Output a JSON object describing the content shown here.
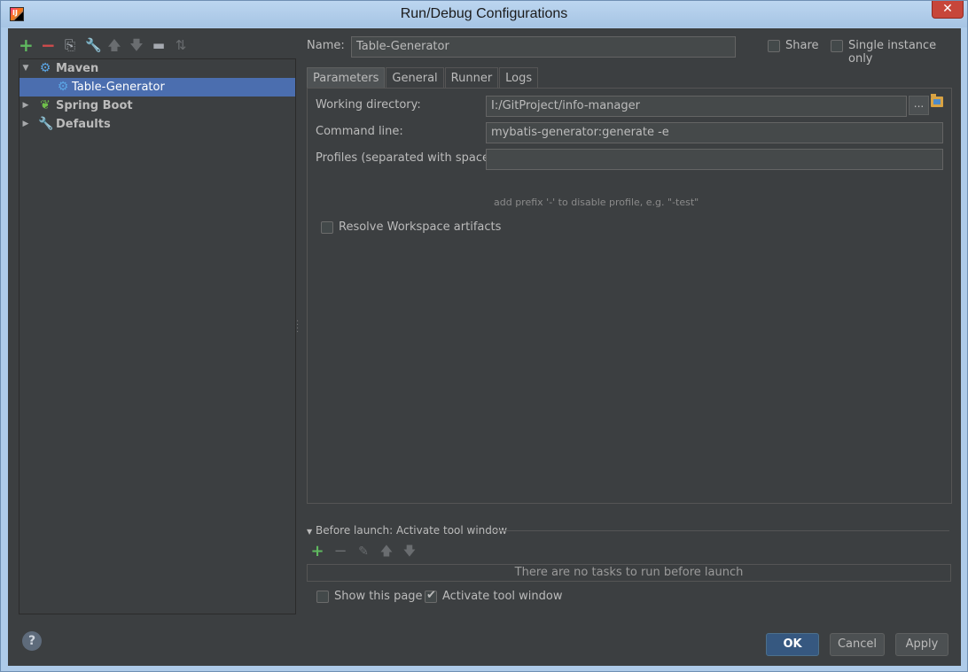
{
  "window": {
    "title": "Run/Debug Configurations"
  },
  "toolbar": {
    "icons": [
      "add-icon",
      "remove-icon",
      "copy-icon",
      "edit-defaults-icon",
      "move-up-icon",
      "move-down-icon",
      "folder-icon",
      "sort-icon"
    ],
    "add_glyph": "+",
    "remove_glyph": "−"
  },
  "tree": {
    "items": [
      {
        "label": "Maven",
        "expanded": true,
        "icon": "gear-icon"
      },
      {
        "label": "Table-Generator",
        "selected": true,
        "icon": "gear-icon"
      },
      {
        "label": "Spring Boot",
        "expanded": false,
        "icon": "spring-leaf-icon"
      },
      {
        "label": "Defaults",
        "expanded": false,
        "icon": "wrench-icon"
      }
    ]
  },
  "name": {
    "label": "Name:",
    "value": "Table-Generator"
  },
  "share": {
    "label": "Share",
    "checked": false
  },
  "single_instance": {
    "label": "Single instance only",
    "checked": false
  },
  "tabs": [
    {
      "label": "Parameters",
      "active": true
    },
    {
      "label": "General"
    },
    {
      "label": "Runner"
    },
    {
      "label": "Logs"
    }
  ],
  "parameters": {
    "working_directory": {
      "label": "Working directory:",
      "value": "I:/GitProject/info-manager",
      "browse": "..."
    },
    "command_line": {
      "label": "Command line:",
      "value": "mybatis-generator:generate -e"
    },
    "profiles": {
      "label": "Profiles (separated with space):",
      "value": "",
      "hint": "add prefix '-' to disable profile, e.g. \"-test\""
    },
    "resolve_workspace": {
      "label": "Resolve Workspace artifacts",
      "checked": false
    }
  },
  "before_launch": {
    "header": "Before launch: Activate tool window",
    "empty_text": "There are no tasks to run before launch",
    "add_glyph": "+",
    "remove_glyph": "−"
  },
  "show_this_page": {
    "label": "Show this page",
    "checked": false
  },
  "activate_tool_window": {
    "label": "Activate tool window",
    "checked": true
  },
  "buttons": {
    "help": "?",
    "ok": "OK",
    "cancel": "Cancel",
    "apply": "Apply"
  },
  "colors": {
    "background": "#3c3f41",
    "selection": "#4b6eaf",
    "ok_button": "#365880",
    "add": "#5fb85f",
    "remove": "#d24c4c"
  }
}
